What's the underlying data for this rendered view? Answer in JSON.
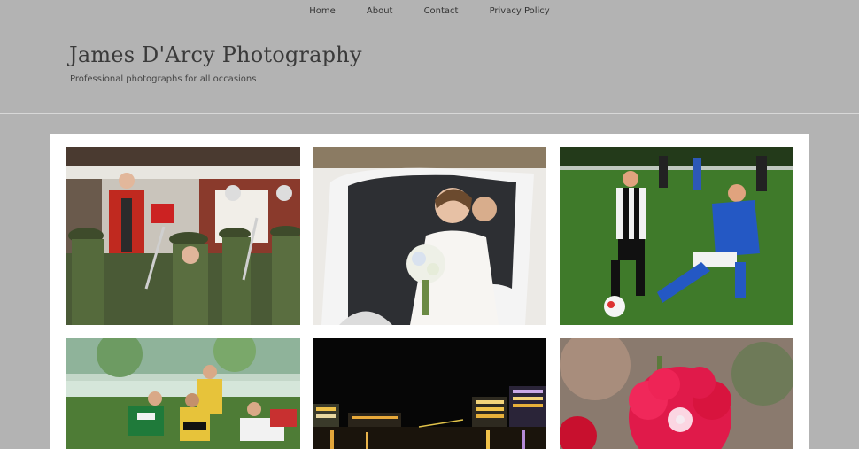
{
  "nav": {
    "items": [
      {
        "label": "Home"
      },
      {
        "label": "About"
      },
      {
        "label": "Contact"
      },
      {
        "label": "Privacy Policy"
      }
    ]
  },
  "site": {
    "title": "James D'Arcy Photography",
    "tagline": "Professional photographs for all occasions"
  },
  "gallery": {
    "items": [
      {
        "subject": "mayor-guard-of-honour"
      },
      {
        "subject": "bride-in-car"
      },
      {
        "subject": "womens-football"
      },
      {
        "subject": "rugby-match"
      },
      {
        "subject": "city-night-waterfront"
      },
      {
        "subject": "red-carnation"
      }
    ]
  },
  "colors": {
    "page_background": "#b3b3b3",
    "panel_background": "#ffffff",
    "title_text": "#3a3a3a"
  }
}
